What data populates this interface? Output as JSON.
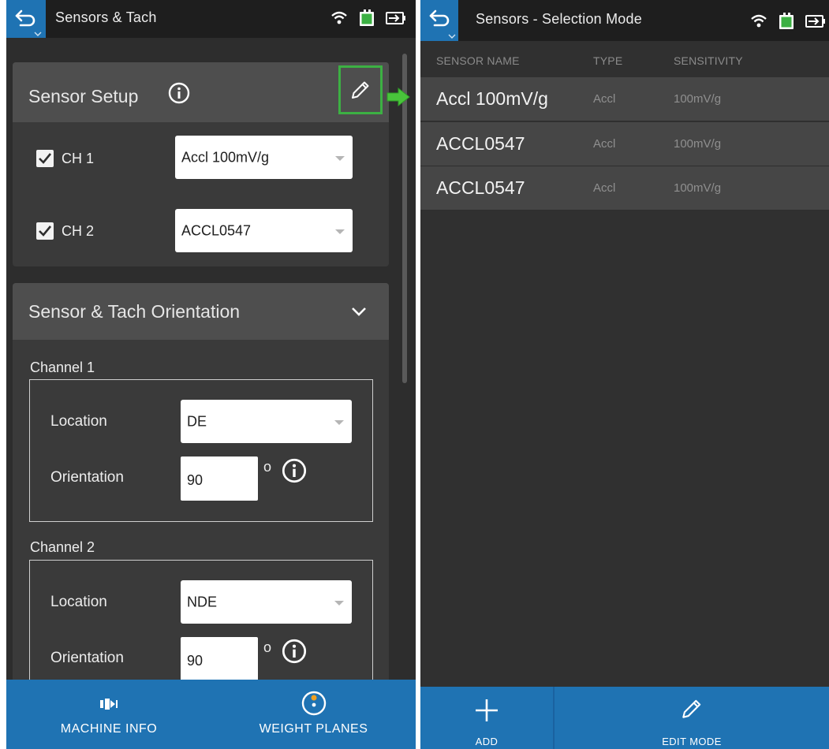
{
  "colors": {
    "accent_blue": "#1f73b3",
    "highlight_green": "#3cb043",
    "background": "#2d2d2d",
    "card": "#3a3a3a",
    "card_header": "#4e4e4e"
  },
  "left_screen": {
    "title": "Sensors & Tach",
    "status_icons": [
      "wifi-icon",
      "battery-icon",
      "charging-icon"
    ],
    "sensor_setup": {
      "title": "Sensor Setup",
      "channels": [
        {
          "label": "CH 1",
          "checked": true,
          "sensor": "Accl 100mV/g"
        },
        {
          "label": "CH 2",
          "checked": true,
          "sensor": "ACCL0547"
        }
      ]
    },
    "orientation": {
      "title": "Sensor & Tach Orientation",
      "channels": [
        {
          "label": "Channel 1",
          "location_label": "Location",
          "location": "DE",
          "orientation_label": "Orientation",
          "orientation": "90",
          "unit": "o"
        },
        {
          "label": "Channel 2",
          "location_label": "Location",
          "location": "NDE",
          "orientation_label": "Orientation",
          "orientation": "90",
          "unit": "o"
        }
      ]
    },
    "bottom_nav": [
      {
        "label": "MACHINE INFO",
        "icon": "machine-icon"
      },
      {
        "label": "WEIGHT PLANES",
        "icon": "weight-plane-icon"
      }
    ]
  },
  "right_screen": {
    "title": "Sensors - Selection Mode",
    "status_icons": [
      "wifi-icon",
      "battery-icon",
      "charging-icon"
    ],
    "columns": [
      "SENSOR NAME",
      "TYPE",
      "SENSITIVITY"
    ],
    "sensors": [
      {
        "name": "Accl 100mV/g",
        "type": "Accl",
        "sensitivity": "100mV/g"
      },
      {
        "name": "ACCL0547",
        "type": "Accl",
        "sensitivity": "100mV/g"
      },
      {
        "name": "ACCL0547",
        "type": "Accl",
        "sensitivity": "100mV/g"
      }
    ],
    "bottom_nav": [
      {
        "label": "ADD",
        "icon": "plus-icon"
      },
      {
        "label": "EDIT MODE",
        "icon": "pencil-icon"
      }
    ]
  }
}
